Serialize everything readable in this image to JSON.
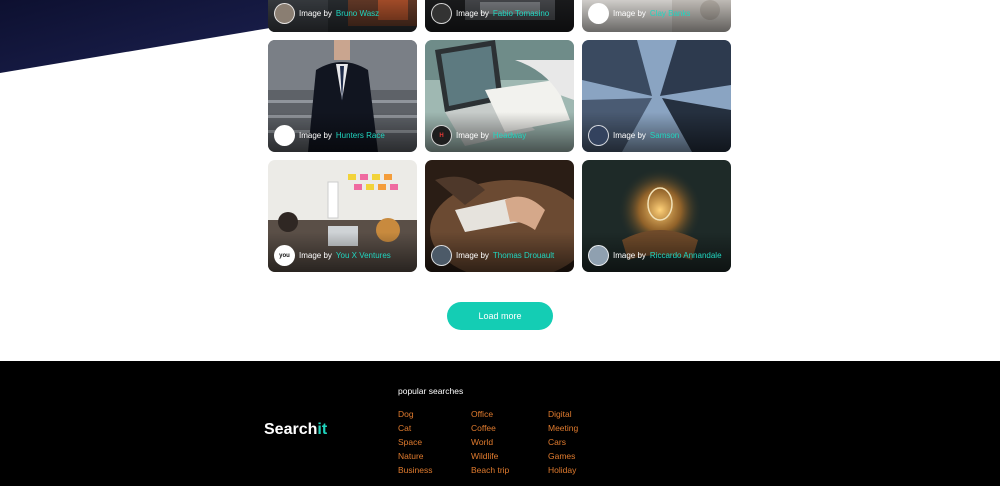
{
  "cards": [
    {
      "prefix": "Image by",
      "author": "Bruno Wasz",
      "avatar_glyph": "",
      "photo": "top-photo-1"
    },
    {
      "prefix": "Image by",
      "author": "Fabio Tomasino",
      "avatar_glyph": "",
      "photo": "top-photo-2"
    },
    {
      "prefix": "Image by",
      "author": "Clay Banks",
      "avatar_glyph": "",
      "photo": "top-photo-3"
    },
    {
      "prefix": "Image by",
      "author": "Hunters Race",
      "avatar_glyph": "",
      "photo": "businessman-suit-photo"
    },
    {
      "prefix": "Image by",
      "author": "Headway",
      "avatar_glyph": "H",
      "photo": "laptop-desk-photo"
    },
    {
      "prefix": "Image by",
      "author": "Samson",
      "avatar_glyph": "",
      "photo": "skyscrapers-photo"
    },
    {
      "prefix": "Image by",
      "author": "You X Ventures",
      "avatar_glyph": "you",
      "photo": "team-meeting-photo"
    },
    {
      "prefix": "Image by",
      "author": "Thomas Drouault",
      "avatar_glyph": "",
      "photo": "hands-paper-photo"
    },
    {
      "prefix": "Image by",
      "author": "Riccardo Annandale",
      "avatar_glyph": "",
      "photo": "light-bulb-photo"
    }
  ],
  "load_more": "Load more",
  "footer": {
    "logo_main": "Search",
    "logo_accent": "it",
    "popular_title": "popular searches",
    "columns": [
      [
        "Dog",
        "Cat",
        "Space",
        "Nature",
        "Business"
      ],
      [
        "Office",
        "Coffee",
        "World",
        "Wildlife",
        "Beach trip"
      ],
      [
        "Digital",
        "Meeting",
        "Cars",
        "Games",
        "Holiday"
      ]
    ]
  },
  "colors": {
    "accent": "#14cdb4",
    "link": "#e07b2e",
    "footer_bg": "#000000",
    "author": "#20d6c0"
  }
}
